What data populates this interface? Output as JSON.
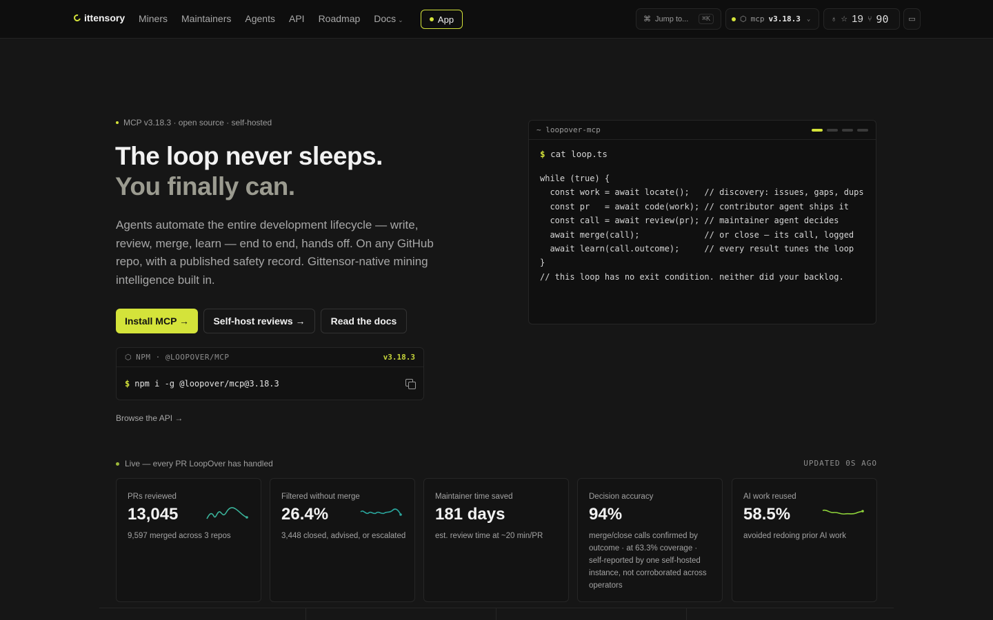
{
  "nav": {
    "brand": "ittensory",
    "links": [
      "Miners",
      "Maintainers",
      "Agents",
      "API",
      "Roadmap",
      "Docs"
    ],
    "app_label": "App",
    "jump_label": "Jump to...",
    "jump_kbd": "⌘K",
    "mcp_label": "mcp",
    "mcp_version": "v3.18.3",
    "stars": "19",
    "forks": "90"
  },
  "hero": {
    "eyebrow": "MCP v3.18.3 · open source · self-hosted",
    "title_line1": "The loop never sleeps.",
    "title_line2": "You finally can.",
    "lede": "Agents automate the entire development lifecycle — write, review, merge, learn — end to end, hands off. On any GitHub repo, with a published safety record. Gittensor-native mining intelligence built in.",
    "btn_install": "Install MCP →",
    "btn_selfhost": "Self-host reviews →",
    "btn_docs": "Read the docs",
    "npm_label": "NPM · @LOOPOVER/MCP",
    "npm_version": "v3.18.3",
    "npm_prompt": "$",
    "npm_command": "npm i -g @loopover/mcp@3.18.3",
    "browse_api": "Browse the API →"
  },
  "terminal": {
    "title": "~ loopover-mcp",
    "prompt": "$",
    "command": "cat loop.ts",
    "code": "while (true) {\n  const work = await locate();   // discovery: issues, gaps, dups\n  const pr   = await code(work); // contributor agent ships it\n  const call = await review(pr); // maintainer agent decides\n  await merge(call);             // or close — its call, logged\n  await learn(call.outcome);     // every result tunes the loop\n}\n// this loop has no exit condition. neither did your backlog."
  },
  "stats": {
    "live_label": "Live — every PR LoopOver has handled",
    "updated": "UPDATED 0S AGO",
    "cards": [
      {
        "label": "PRs reviewed",
        "value": "13,045",
        "desc": "9,597 merged across 3 repos",
        "spark": true,
        "spark_color": "#3ab39a"
      },
      {
        "label": "Filtered without merge",
        "value": "26.4%",
        "desc": "3,448 closed, advised, or escalated",
        "spark": true,
        "spark_color": "#2aa59c"
      },
      {
        "label": "Maintainer time saved",
        "value": "181 days",
        "desc": "est. review time at ~20 min/PR",
        "spark": false,
        "spark_color": ""
      },
      {
        "label": "Decision accuracy",
        "value": "94%",
        "desc": "merge/close calls confirmed by outcome · at 63.3% coverage · self-reported by one self-hosted instance, not corroborated across operators",
        "spark": false,
        "spark_color": ""
      },
      {
        "label": "AI work reused",
        "value": "58.5%",
        "desc": "avoided redoing prior AI work",
        "spark": true,
        "spark_color": "#8fd43a"
      }
    ]
  }
}
